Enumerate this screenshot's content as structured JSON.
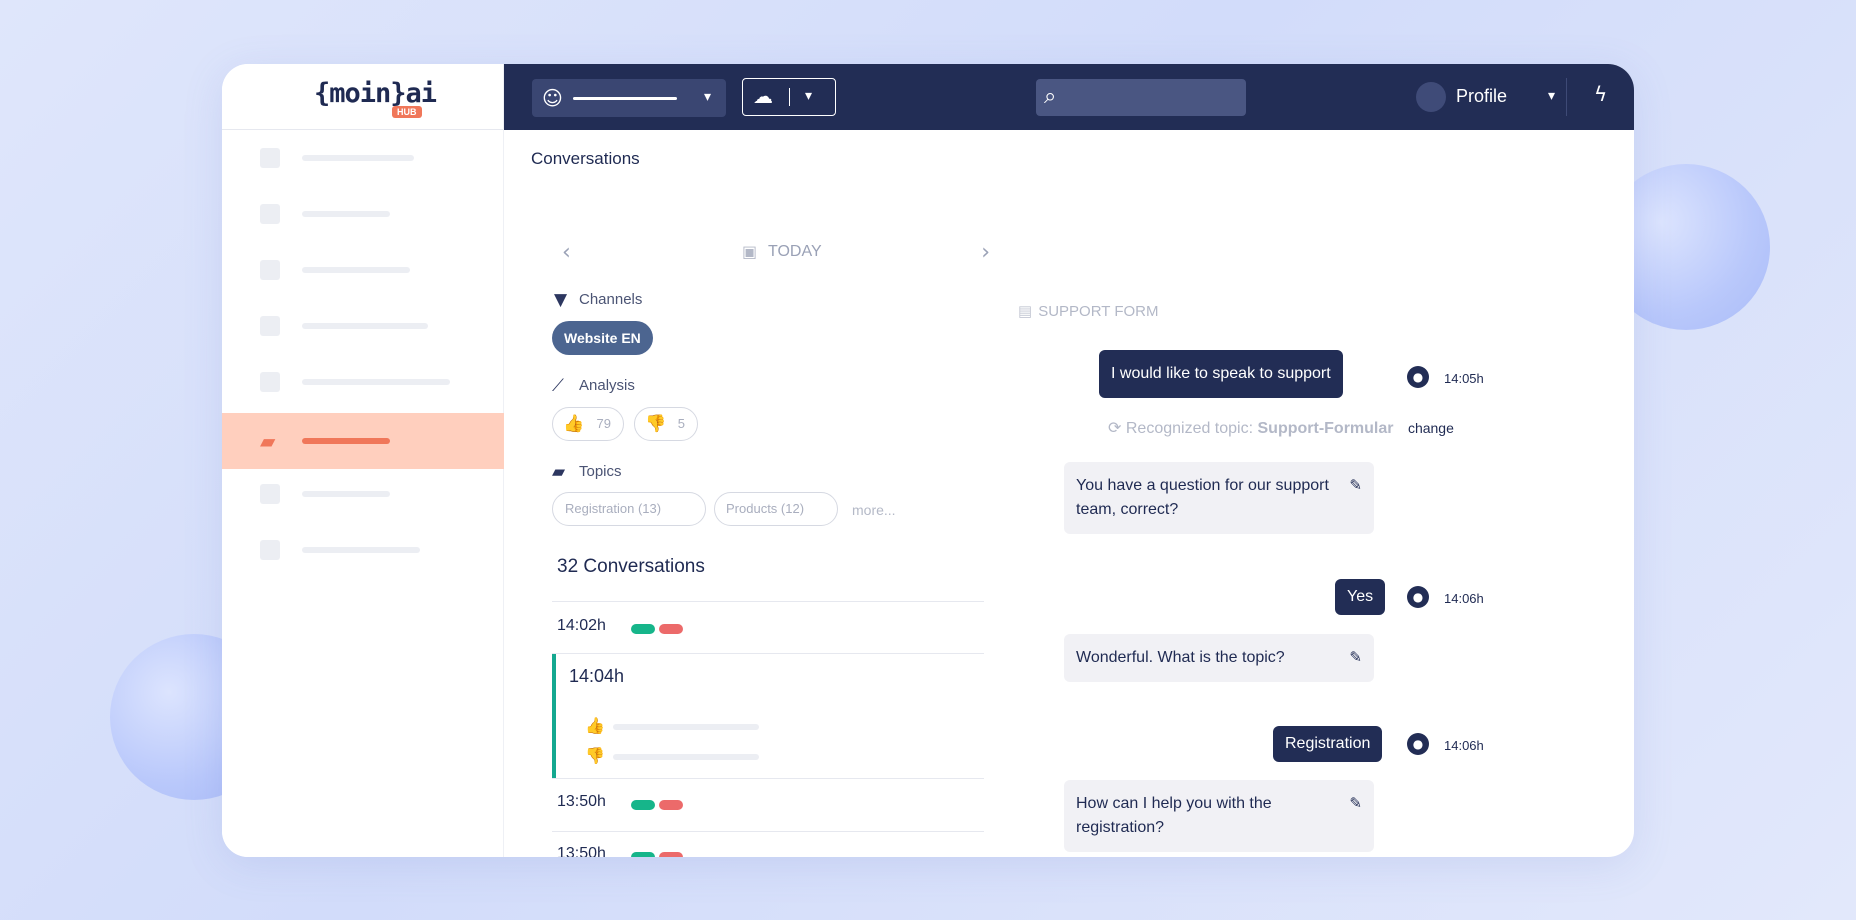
{
  "app": {
    "logo_text": "{moin}ai",
    "logo_badge": "HUB"
  },
  "topbar": {
    "bot_icon": "robot-icon",
    "deploy_icon": "cloud-upload-icon",
    "search_icon": "search-icon",
    "profile_label": "Profile",
    "bolt_icon": "lightning-icon"
  },
  "sidebar": {
    "items": [
      {
        "icon": "dashboard-icon",
        "active": false
      },
      {
        "icon": "trending-icon",
        "active": false
      },
      {
        "icon": "chat-icon",
        "active": false
      },
      {
        "icon": "gauge-icon",
        "active": false
      },
      {
        "icon": "flow-icon",
        "active": false
      },
      {
        "icon": "conversations-icon",
        "active": true
      },
      {
        "icon": "folder-icon",
        "active": false
      },
      {
        "icon": "settings-icon",
        "active": false
      }
    ]
  },
  "page": {
    "title": "Conversations"
  },
  "date_nav": {
    "label": "TODAY",
    "prev": "‹",
    "next": "›"
  },
  "filters": {
    "channels_label": "Channels",
    "channel_chip": "Website EN",
    "analysis_label": "Analysis",
    "positive_count": "79",
    "negative_count": "5",
    "topics_label": "Topics",
    "topics": [
      {
        "label": "Registration (13)"
      },
      {
        "label": "Products (12)"
      }
    ],
    "more_label": "more..."
  },
  "conversations": {
    "count_label": "32 Conversations",
    "items": [
      {
        "time": "14:02h"
      },
      {
        "time": "14:04h"
      },
      {
        "time": "13:50h"
      },
      {
        "time": "13:50h"
      }
    ]
  },
  "chat": {
    "form_label": "SUPPORT FORM",
    "topic_prefix": "Recognized topic:",
    "topic_value": "Support-Formular",
    "change_label": "change",
    "messages": [
      {
        "text": "I would like to speak to support",
        "time": "14:05h"
      },
      {
        "text": "You have a question for our support team, correct?"
      },
      {
        "text": "Yes",
        "time": "14:06h"
      },
      {
        "text": "Wonderful. What is the topic?"
      },
      {
        "text": "Registration",
        "time": "14:06h"
      },
      {
        "text": "How can I help you with the registration?"
      }
    ]
  }
}
